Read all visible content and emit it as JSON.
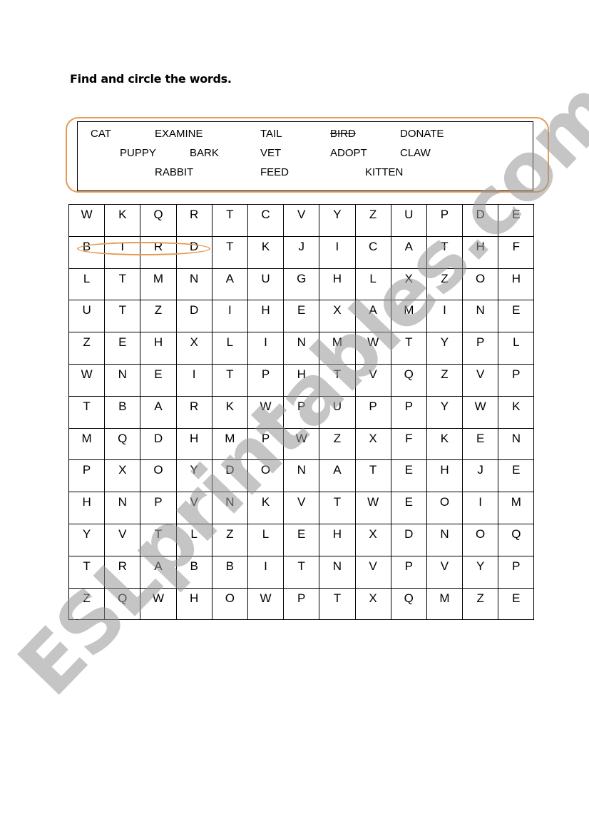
{
  "title": "Find and circle the words.",
  "word_list": [
    {
      "text": "CAT",
      "struck": false
    },
    {
      "text": "EXAMINE",
      "struck": false
    },
    {
      "text": "TAIL",
      "struck": false
    },
    {
      "text": "BIRD",
      "struck": true
    },
    {
      "text": "DONATE",
      "struck": false
    },
    {
      "text": "PUPPY",
      "struck": false
    },
    {
      "text": "BARK",
      "struck": false
    },
    {
      "text": "VET",
      "struck": false
    },
    {
      "text": "ADOPT",
      "struck": false
    },
    {
      "text": "CLAW",
      "struck": false
    },
    {
      "text": "RABBIT",
      "struck": false
    },
    {
      "text": "FEED",
      "struck": false
    },
    {
      "text": "KITTEN",
      "struck": false
    }
  ],
  "grid": [
    [
      "W",
      "K",
      "Q",
      "R",
      "T",
      "C",
      "V",
      "Y",
      "Z",
      "U",
      "P",
      "D",
      "E"
    ],
    [
      "B",
      "I",
      "R",
      "D",
      "T",
      "K",
      "J",
      "I",
      "C",
      "A",
      "T",
      "H",
      "F"
    ],
    [
      "L",
      "T",
      "M",
      "N",
      "A",
      "U",
      "G",
      "H",
      "L",
      "X",
      "Z",
      "O",
      "H"
    ],
    [
      "U",
      "T",
      "Z",
      "D",
      "I",
      "H",
      "E",
      "X",
      "A",
      "M",
      "I",
      "N",
      "E"
    ],
    [
      "Z",
      "E",
      "H",
      "X",
      "L",
      "I",
      "N",
      "M",
      "W",
      "T",
      "Y",
      "P",
      "L"
    ],
    [
      "W",
      "N",
      "E",
      "I",
      "T",
      "P",
      "H",
      "T",
      "V",
      "Q",
      "Z",
      "V",
      "P"
    ],
    [
      "T",
      "B",
      "A",
      "R",
      "K",
      "W",
      "P",
      "U",
      "P",
      "P",
      "Y",
      "W",
      "K"
    ],
    [
      "M",
      "Q",
      "D",
      "H",
      "M",
      "P",
      "W",
      "Z",
      "X",
      "F",
      "K",
      "E",
      "N"
    ],
    [
      "P",
      "X",
      "O",
      "Y",
      "D",
      "O",
      "N",
      "A",
      "T",
      "E",
      "H",
      "J",
      "E"
    ],
    [
      "H",
      "N",
      "P",
      "V",
      "N",
      "K",
      "V",
      "T",
      "W",
      "E",
      "O",
      "I",
      "M"
    ],
    [
      "Y",
      "V",
      "T",
      "L",
      "Z",
      "L",
      "E",
      "H",
      "X",
      "D",
      "N",
      "O",
      "Q"
    ],
    [
      "T",
      "R",
      "A",
      "B",
      "B",
      "I",
      "T",
      "N",
      "V",
      "P",
      "V",
      "Y",
      "P"
    ],
    [
      "Z",
      "Q",
      "W",
      "H",
      "O",
      "W",
      "P",
      "T",
      "X",
      "Q",
      "M",
      "Z",
      "E"
    ]
  ],
  "found": [
    {
      "word": "BIRD",
      "row": 2,
      "cols": "1-4"
    }
  ],
  "watermark": "ESLprintables.com",
  "colors": {
    "accent": "#e69a52",
    "watermark": "#969696"
  }
}
